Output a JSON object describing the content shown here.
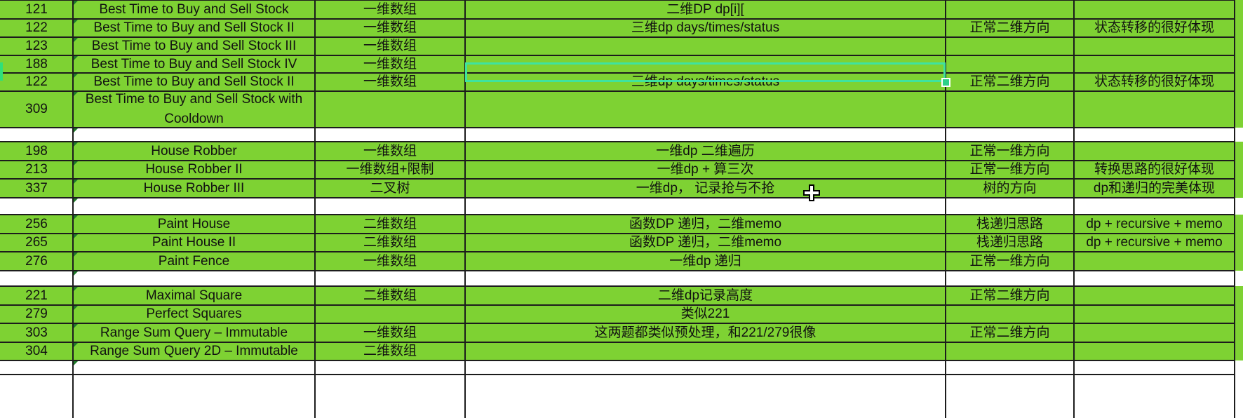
{
  "table": {
    "rows": [
      {
        "kind": "data",
        "cells": [
          "121",
          "Best Time to Buy and Sell Stock",
          "一维数组",
          "二维DP dp[i][",
          "",
          ""
        ]
      },
      {
        "kind": "data",
        "cells": [
          "122",
          "Best Time to Buy and Sell Stock II",
          "一维数组",
          "三维dp days/times/status",
          "正常二维方向",
          "状态转移的很好体现"
        ]
      },
      {
        "kind": "data",
        "cells": [
          "123",
          "Best Time to Buy and Sell Stock III",
          "一维数组",
          "",
          "",
          ""
        ]
      },
      {
        "kind": "data",
        "cells": [
          "188",
          "Best Time to Buy and Sell Stock IV",
          "一维数组",
          "",
          "",
          ""
        ]
      },
      {
        "kind": "data",
        "cells": [
          "122",
          "Best Time to Buy and Sell Stock II",
          "一维数组",
          "三维dp days/times/status",
          "正常二维方向",
          "状态转移的很好体现"
        ]
      },
      {
        "kind": "data",
        "cells": [
          "309",
          "Best Time to Buy and Sell Stock with Cooldown",
          "",
          "",
          "",
          ""
        ]
      },
      {
        "kind": "blank",
        "cells": [
          "",
          "",
          "",
          "",
          "",
          ""
        ]
      },
      {
        "kind": "data",
        "cells": [
          "198",
          "House Robber",
          "一维数组",
          "一维dp 二维遍历",
          "正常一维方向",
          ""
        ]
      },
      {
        "kind": "data",
        "cells": [
          "213",
          "House Robber II",
          "一维数组+限制",
          "一维dp + 算三次",
          "正常一维方向",
          "转换思路的很好体现"
        ]
      },
      {
        "kind": "data",
        "cells": [
          "337",
          "House Robber III",
          "二叉树",
          "一维dp， 记录抢与不抢",
          "树的方向",
          "dp和递归的完美体现"
        ]
      },
      {
        "kind": "blank",
        "cells": [
          "",
          "",
          "",
          "",
          "",
          ""
        ]
      },
      {
        "kind": "data",
        "cells": [
          "256",
          "Paint House",
          "二维数组",
          "函数DP 递归，二维memo",
          "栈递归思路",
          "dp + recursive + memo"
        ]
      },
      {
        "kind": "data",
        "cells": [
          "265",
          "Paint House II",
          "二维数组",
          "函数DP 递归，二维memo",
          "栈递归思路",
          "dp + recursive + memo"
        ]
      },
      {
        "kind": "data",
        "cells": [
          "276",
          "Paint Fence",
          "一维数组",
          "一维dp 递归",
          "正常一维方向",
          ""
        ]
      },
      {
        "kind": "blank",
        "cells": [
          "",
          "",
          "",
          "",
          "",
          ""
        ]
      },
      {
        "kind": "data",
        "cells": [
          "221",
          "Maximal Square",
          "二维数组",
          "二维dp记录高度",
          "正常二维方向",
          ""
        ]
      },
      {
        "kind": "data",
        "cells": [
          "279",
          "Perfect Squares",
          "",
          "类似221",
          "",
          ""
        ]
      },
      {
        "kind": "data",
        "cells": [
          "303",
          "Range Sum Query – Immutable",
          "一维数组",
          "这两题都类似预处理，和221/279很像",
          "正常二维方向",
          ""
        ]
      },
      {
        "kind": "data",
        "cells": [
          "304",
          "Range Sum Query 2D – Immutable",
          "二维数组",
          "",
          "",
          ""
        ]
      },
      {
        "kind": "blank",
        "cells": [
          "",
          "",
          "",
          "",
          "",
          ""
        ]
      }
    ]
  },
  "selection": {
    "row": 3,
    "column": 3
  },
  "colors": {
    "cell_fill": "#7ed233",
    "grid_line": "#1c1c1c",
    "selection": "#3ee3a0",
    "blank_row": "#ffffff"
  },
  "icons": {
    "cursor": "move-cursor-icon",
    "fill_handle": "fill-handle-icon"
  }
}
